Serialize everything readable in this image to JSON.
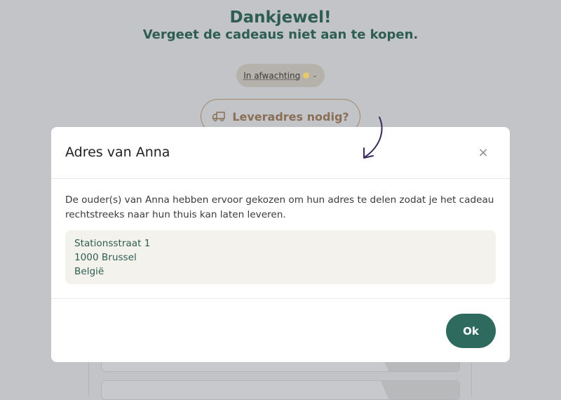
{
  "background": {
    "title": "Dankjewel!",
    "subtitle": "Vergeet de cadeaus niet aan te kopen.",
    "status": {
      "label": "In afwachting",
      "icon": "chevron-down-icon"
    },
    "address_button": {
      "label": "Leveradres nodig?",
      "icon": "truck-icon"
    }
  },
  "modal": {
    "title": "Adres van Anna",
    "close_icon": "×",
    "description": "De ouder(s) van Anna hebben ervoor gekozen om hun adres te delen zodat je het cadeau rechtstreeks naar hun thuis kan laten leveren.",
    "address": {
      "street": "Stationsstraat 1",
      "city": "1000 Brussel",
      "country": "België"
    },
    "ok_label": "Ok"
  },
  "colors": {
    "brand_green": "#2e6b5e",
    "overlay": "#c3c4c8",
    "status_dot": "#e5c86b",
    "address_bg": "#f3f2ed"
  }
}
